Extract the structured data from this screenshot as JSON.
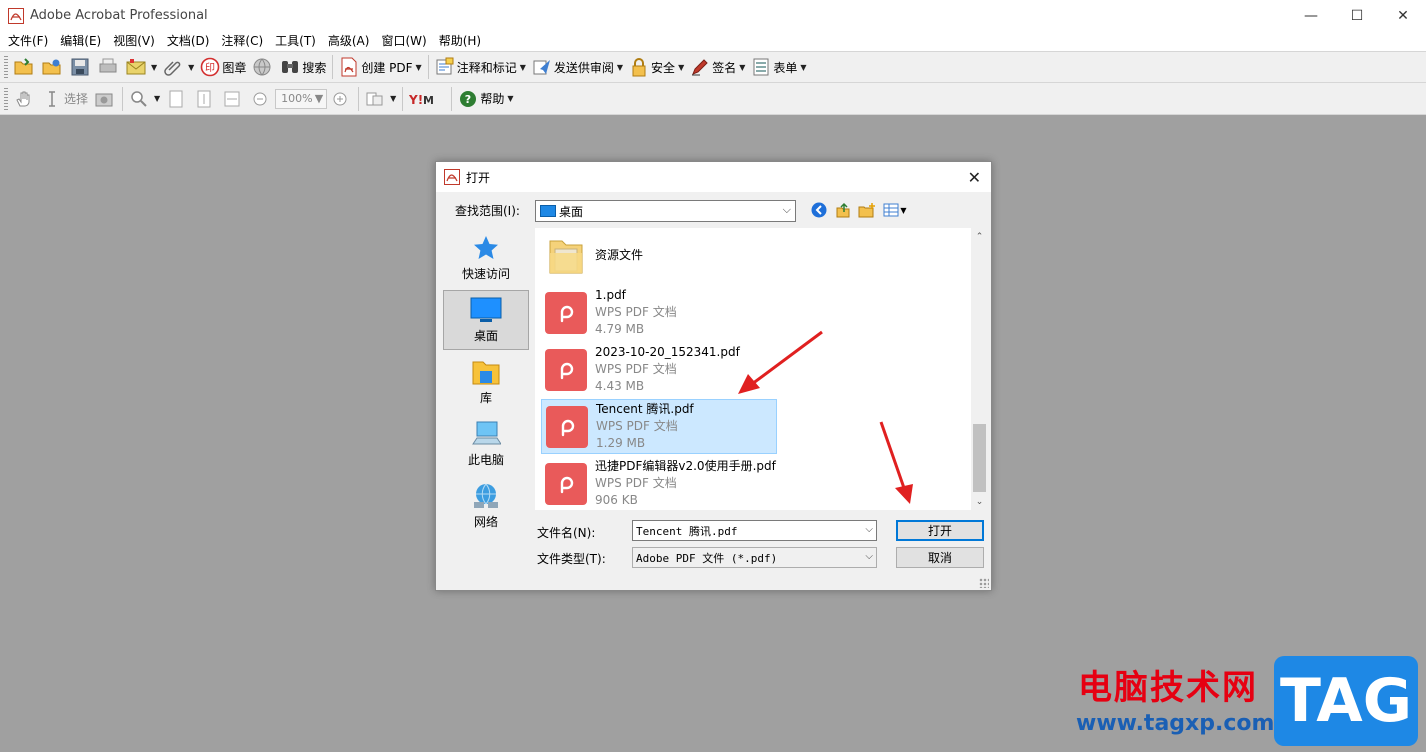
{
  "window": {
    "title": "Adobe Acrobat Professional",
    "controls": {
      "minimize": "—",
      "maximize": "☐",
      "close": "✕"
    }
  },
  "menu": [
    "文件(F)",
    "编辑(E)",
    "视图(V)",
    "文档(D)",
    "注释(C)",
    "工具(T)",
    "高级(A)",
    "窗口(W)",
    "帮助(H)"
  ],
  "toolbar1": {
    "stamp": "图章",
    "search": "搜索",
    "create_pdf": "创建 PDF",
    "comment": "注释和标记",
    "send_review": "发送供审阅",
    "security": "安全",
    "sign": "签名",
    "forms": "表单"
  },
  "toolbar2": {
    "select": "选择",
    "zoom": "100%",
    "help": "帮助"
  },
  "dialog": {
    "title": "打开",
    "close": "✕",
    "look_in_label": "查找范围(I):",
    "look_in_value": "桌面",
    "places": [
      {
        "label": "快速访问",
        "icon": "star-icon"
      },
      {
        "label": "桌面",
        "icon": "desktop-icon"
      },
      {
        "label": "库",
        "icon": "library-icon"
      },
      {
        "label": "此电脑",
        "icon": "computer-icon"
      },
      {
        "label": "网络",
        "icon": "network-icon"
      }
    ],
    "files": [
      {
        "name": "资源文件",
        "type": "",
        "size": "",
        "kind": "folder"
      },
      {
        "name": "1.pdf",
        "type": "WPS PDF 文档",
        "size": "4.79 MB",
        "kind": "pdf"
      },
      {
        "name": "2023-10-20_152341.pdf",
        "type": "WPS PDF 文档",
        "size": "4.43 MB",
        "kind": "pdf"
      },
      {
        "name": "Tencent 腾讯.pdf",
        "type": "WPS PDF 文档",
        "size": "1.29 MB",
        "kind": "pdf"
      },
      {
        "name": "迅捷PDF编辑器v2.0使用手册.pdf",
        "type": "WPS PDF 文档",
        "size": "906 KB",
        "kind": "pdf"
      }
    ],
    "filename_label": "文件名(N):",
    "filename_value": "Tencent 腾讯.pdf",
    "filetype_label": "文件类型(T):",
    "filetype_value": "Adobe PDF 文件 (*.pdf)",
    "open_button": "打开",
    "cancel_button": "取消"
  },
  "watermark": {
    "title": "电脑技术网",
    "url": "www.tagxp.com",
    "tag": "TAG"
  },
  "colors": {
    "pdf_icon": "#e95a5a",
    "selection": "#cce8ff",
    "arrow": "#e02020",
    "watermark_red": "#e60012",
    "watermark_blue": "#1e88e5"
  }
}
